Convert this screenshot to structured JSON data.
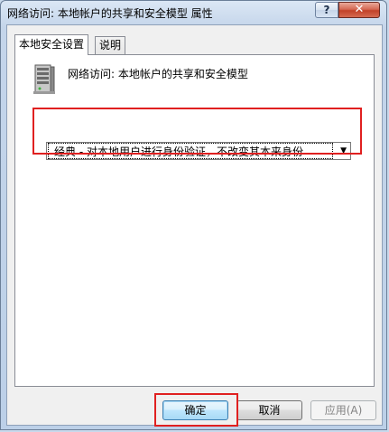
{
  "window": {
    "title": "网络访问: 本地帐户的共享和安全模型 属性",
    "help_label": "?",
    "close_label": "✕"
  },
  "tabs": [
    {
      "label": "本地安全设置",
      "active": true
    },
    {
      "label": "说明",
      "active": false
    }
  ],
  "policy": {
    "icon": "server-icon",
    "title": "网络访问: 本地帐户的共享和安全模型",
    "selected_option": "经典 - 对本地用户进行身份验证，不改变其本来身份"
  },
  "buttons": {
    "ok": "确定",
    "cancel": "取消",
    "apply": "应用(A)"
  },
  "colors": {
    "highlight": "#e02020",
    "title_bar": "#c4d5ea"
  }
}
